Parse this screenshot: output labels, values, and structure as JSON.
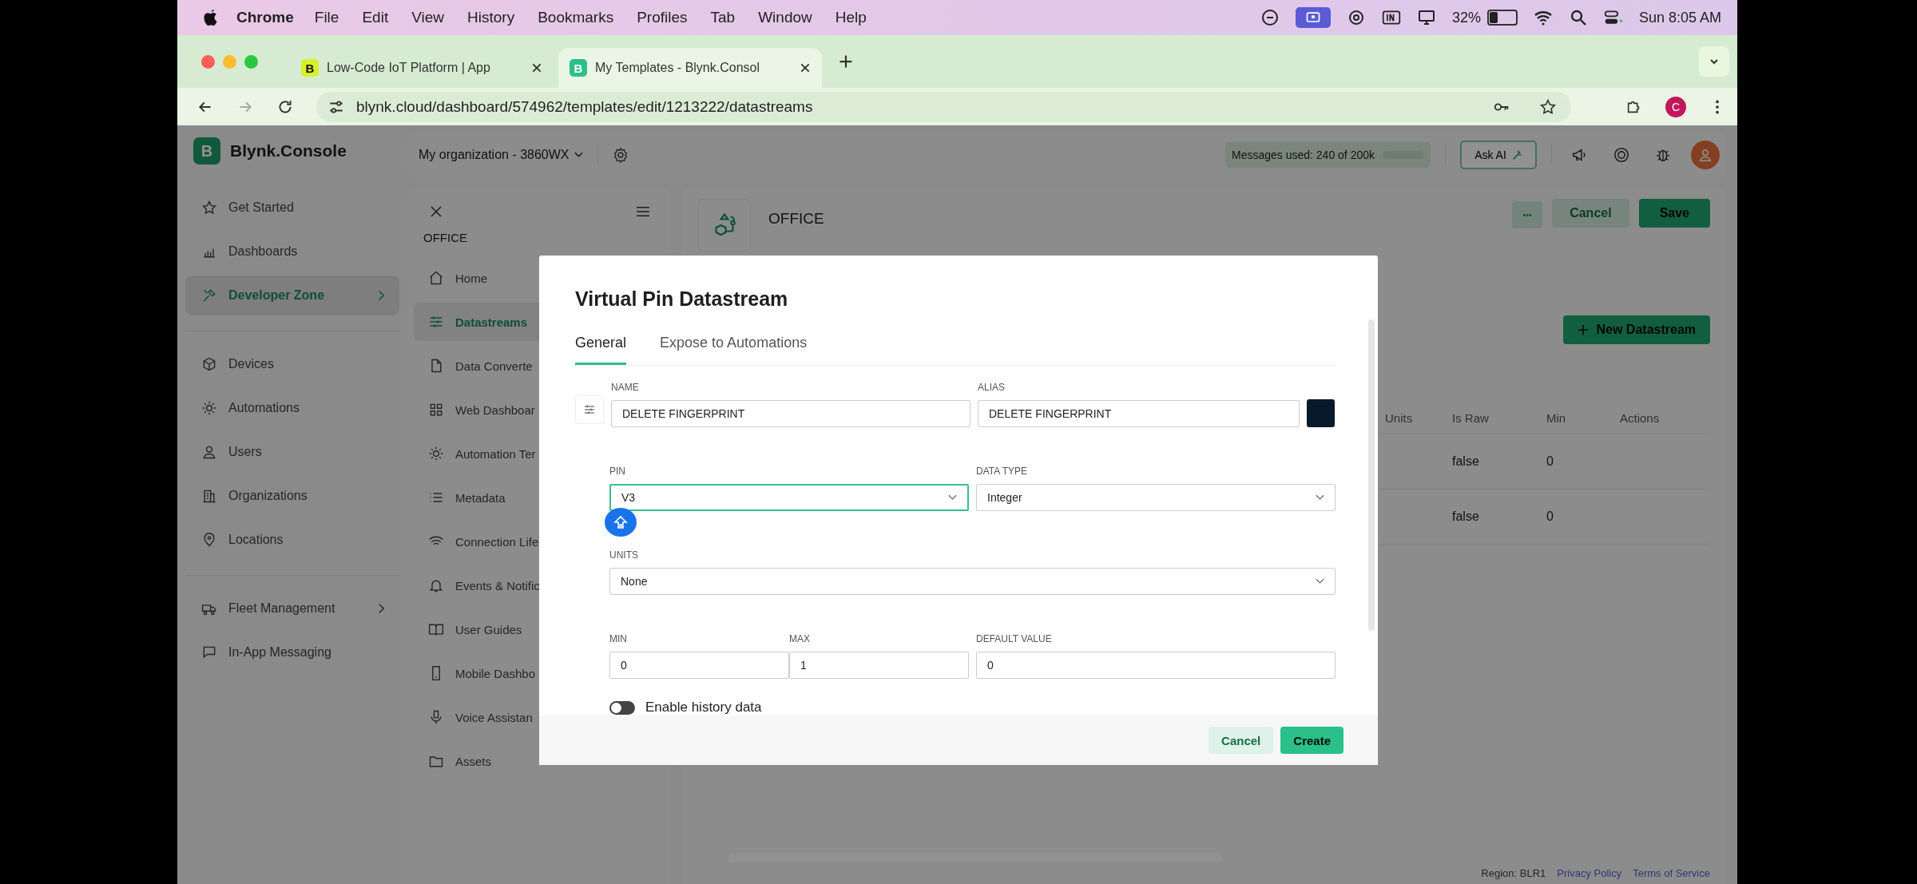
{
  "menu_bar": {
    "app": "Chrome",
    "items": [
      "File",
      "Edit",
      "View",
      "History",
      "Bookmarks",
      "Profiles",
      "Tab",
      "Window",
      "Help"
    ],
    "battery": "32%",
    "clock": "Sun 8:05 AM"
  },
  "browser_tabs": [
    {
      "title": "Low-Code IoT Platform | App",
      "favicon": "B",
      "selected": false
    },
    {
      "title": "My Templates - Blynk.Consol",
      "favicon": "B",
      "selected": true
    }
  ],
  "address_bar": {
    "url": "blynk.cloud/dashboard/574962/templates/edit/1213222/datastreams",
    "profile": "C"
  },
  "header": {
    "brand_letter": "B",
    "brand": "Blynk.Console",
    "organization": "My organization - 3860WX",
    "messages": "Messages used: 240 of 200k",
    "level": 0.0012,
    "ask_ai": "Ask AI"
  },
  "sidebar": {
    "groups": [
      [
        {
          "label": "Get Started",
          "selected": false,
          "submenu": false
        },
        {
          "label": "Dashboards",
          "selected": false,
          "submenu": false
        },
        {
          "label": "Developer Zone",
          "selected": true,
          "submenu": true
        }
      ],
      [
        {
          "label": "Devices",
          "selected": false,
          "submenu": false
        },
        {
          "label": "Automations",
          "selected": false,
          "submenu": false
        },
        {
          "label": "Users",
          "selected": false,
          "submenu": false
        },
        {
          "label": "Organizations",
          "selected": false,
          "submenu": false
        },
        {
          "label": "Locations",
          "selected": false,
          "submenu": false
        }
      ],
      [
        {
          "label": "Fleet Management",
          "selected": false,
          "submenu": true
        },
        {
          "label": "In-App Messaging",
          "selected": false,
          "submenu": false
        }
      ]
    ]
  },
  "template_panel": {
    "title": "OFFICE",
    "items": [
      {
        "label": "Home",
        "selected": false
      },
      {
        "label": "Datastreams",
        "selected": true
      },
      {
        "label": "Data Converte",
        "selected": false
      },
      {
        "label": "Web Dashboar",
        "selected": false
      },
      {
        "label": "Automation Ter",
        "selected": false
      },
      {
        "label": "Metadata",
        "selected": false
      },
      {
        "label": "Connection Life",
        "selected": false
      },
      {
        "label": "Events & Notific",
        "selected": false
      },
      {
        "label": "User Guides",
        "selected": false
      },
      {
        "label": "Mobile Dashbo",
        "selected": false
      },
      {
        "label": "Voice Assistan",
        "selected": false
      },
      {
        "label": "Assets",
        "selected": false
      }
    ]
  },
  "main": {
    "title": "OFFICE",
    "more": "•••",
    "cancel": "Cancel",
    "save": "Save",
    "new_datastream": "New Datastream",
    "table": {
      "columns": [
        "Units",
        "Is Raw",
        "Min",
        "Actions"
      ],
      "rows": [
        {
          "is_raw": "false",
          "min": "0"
        },
        {
          "is_raw": "false",
          "min": "0"
        }
      ]
    }
  },
  "modal": {
    "title": "Virtual Pin Datastream",
    "tabs": [
      {
        "label": "General",
        "selected": true
      },
      {
        "label": "Expose to Automations",
        "selected": false
      }
    ],
    "name": {
      "label": "NAME",
      "value": "DELETE FINGERPRINT"
    },
    "alias": {
      "label": "ALIAS",
      "value": "DELETE FINGERPRINT"
    },
    "pin": {
      "label": "PIN",
      "value": "V3",
      "focused": true
    },
    "data_type": {
      "label": "DATA TYPE",
      "value": "Integer"
    },
    "units": {
      "label": "UNITS",
      "value": "None"
    },
    "min": {
      "label": "MIN",
      "value": "0"
    },
    "max": {
      "label": "MAX",
      "value": "1"
    },
    "default_value": {
      "label": "DEFAULT VALUE",
      "value": "0"
    },
    "history": {
      "label": "Enable history data",
      "on": false
    },
    "cancel": "Cancel",
    "create": "Create"
  },
  "footer": {
    "region": "Region: BLR1",
    "links": [
      "Privacy Policy",
      "Terms of Service"
    ]
  }
}
